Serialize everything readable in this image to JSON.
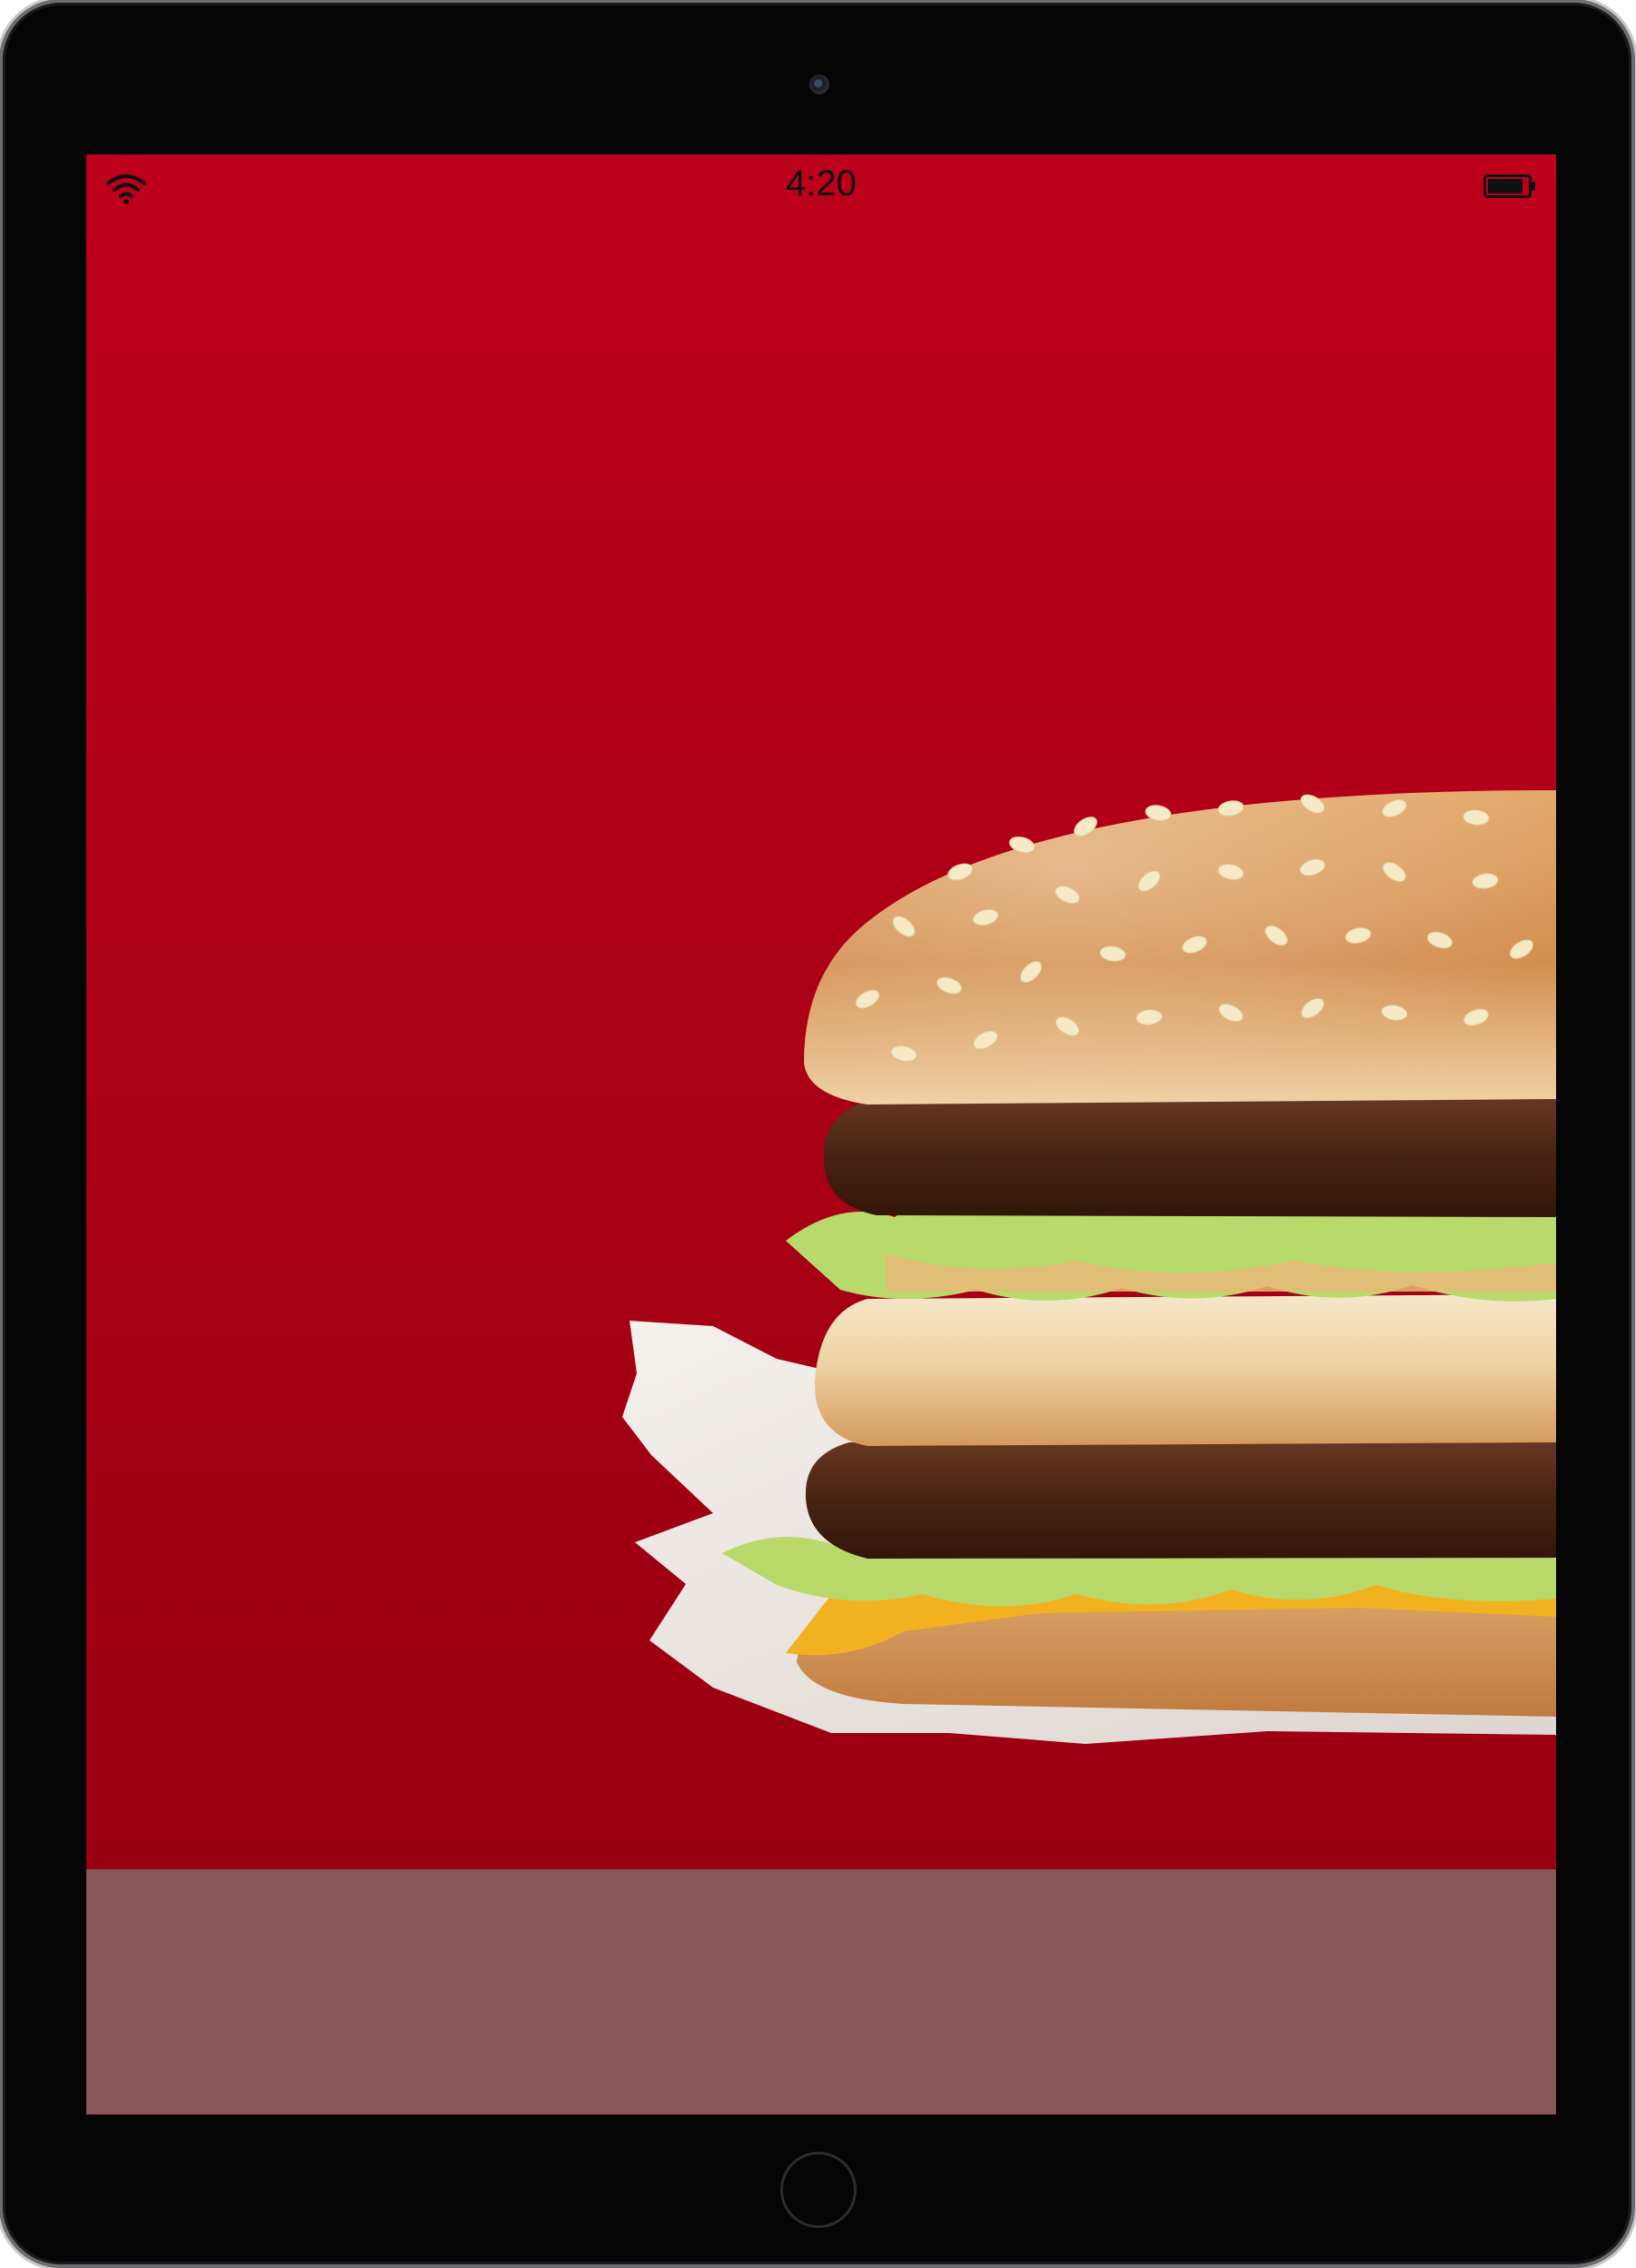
{
  "device": {
    "type": "tablet",
    "frame_color": "#050505"
  },
  "status_bar": {
    "time": "4:20",
    "wifi_icon": "wifi-icon",
    "battery_icon": "battery-icon"
  },
  "hero": {
    "image": "burger-photo",
    "background_color": "#b10018"
  },
  "bottom_panel": {
    "color": "#86565a"
  }
}
